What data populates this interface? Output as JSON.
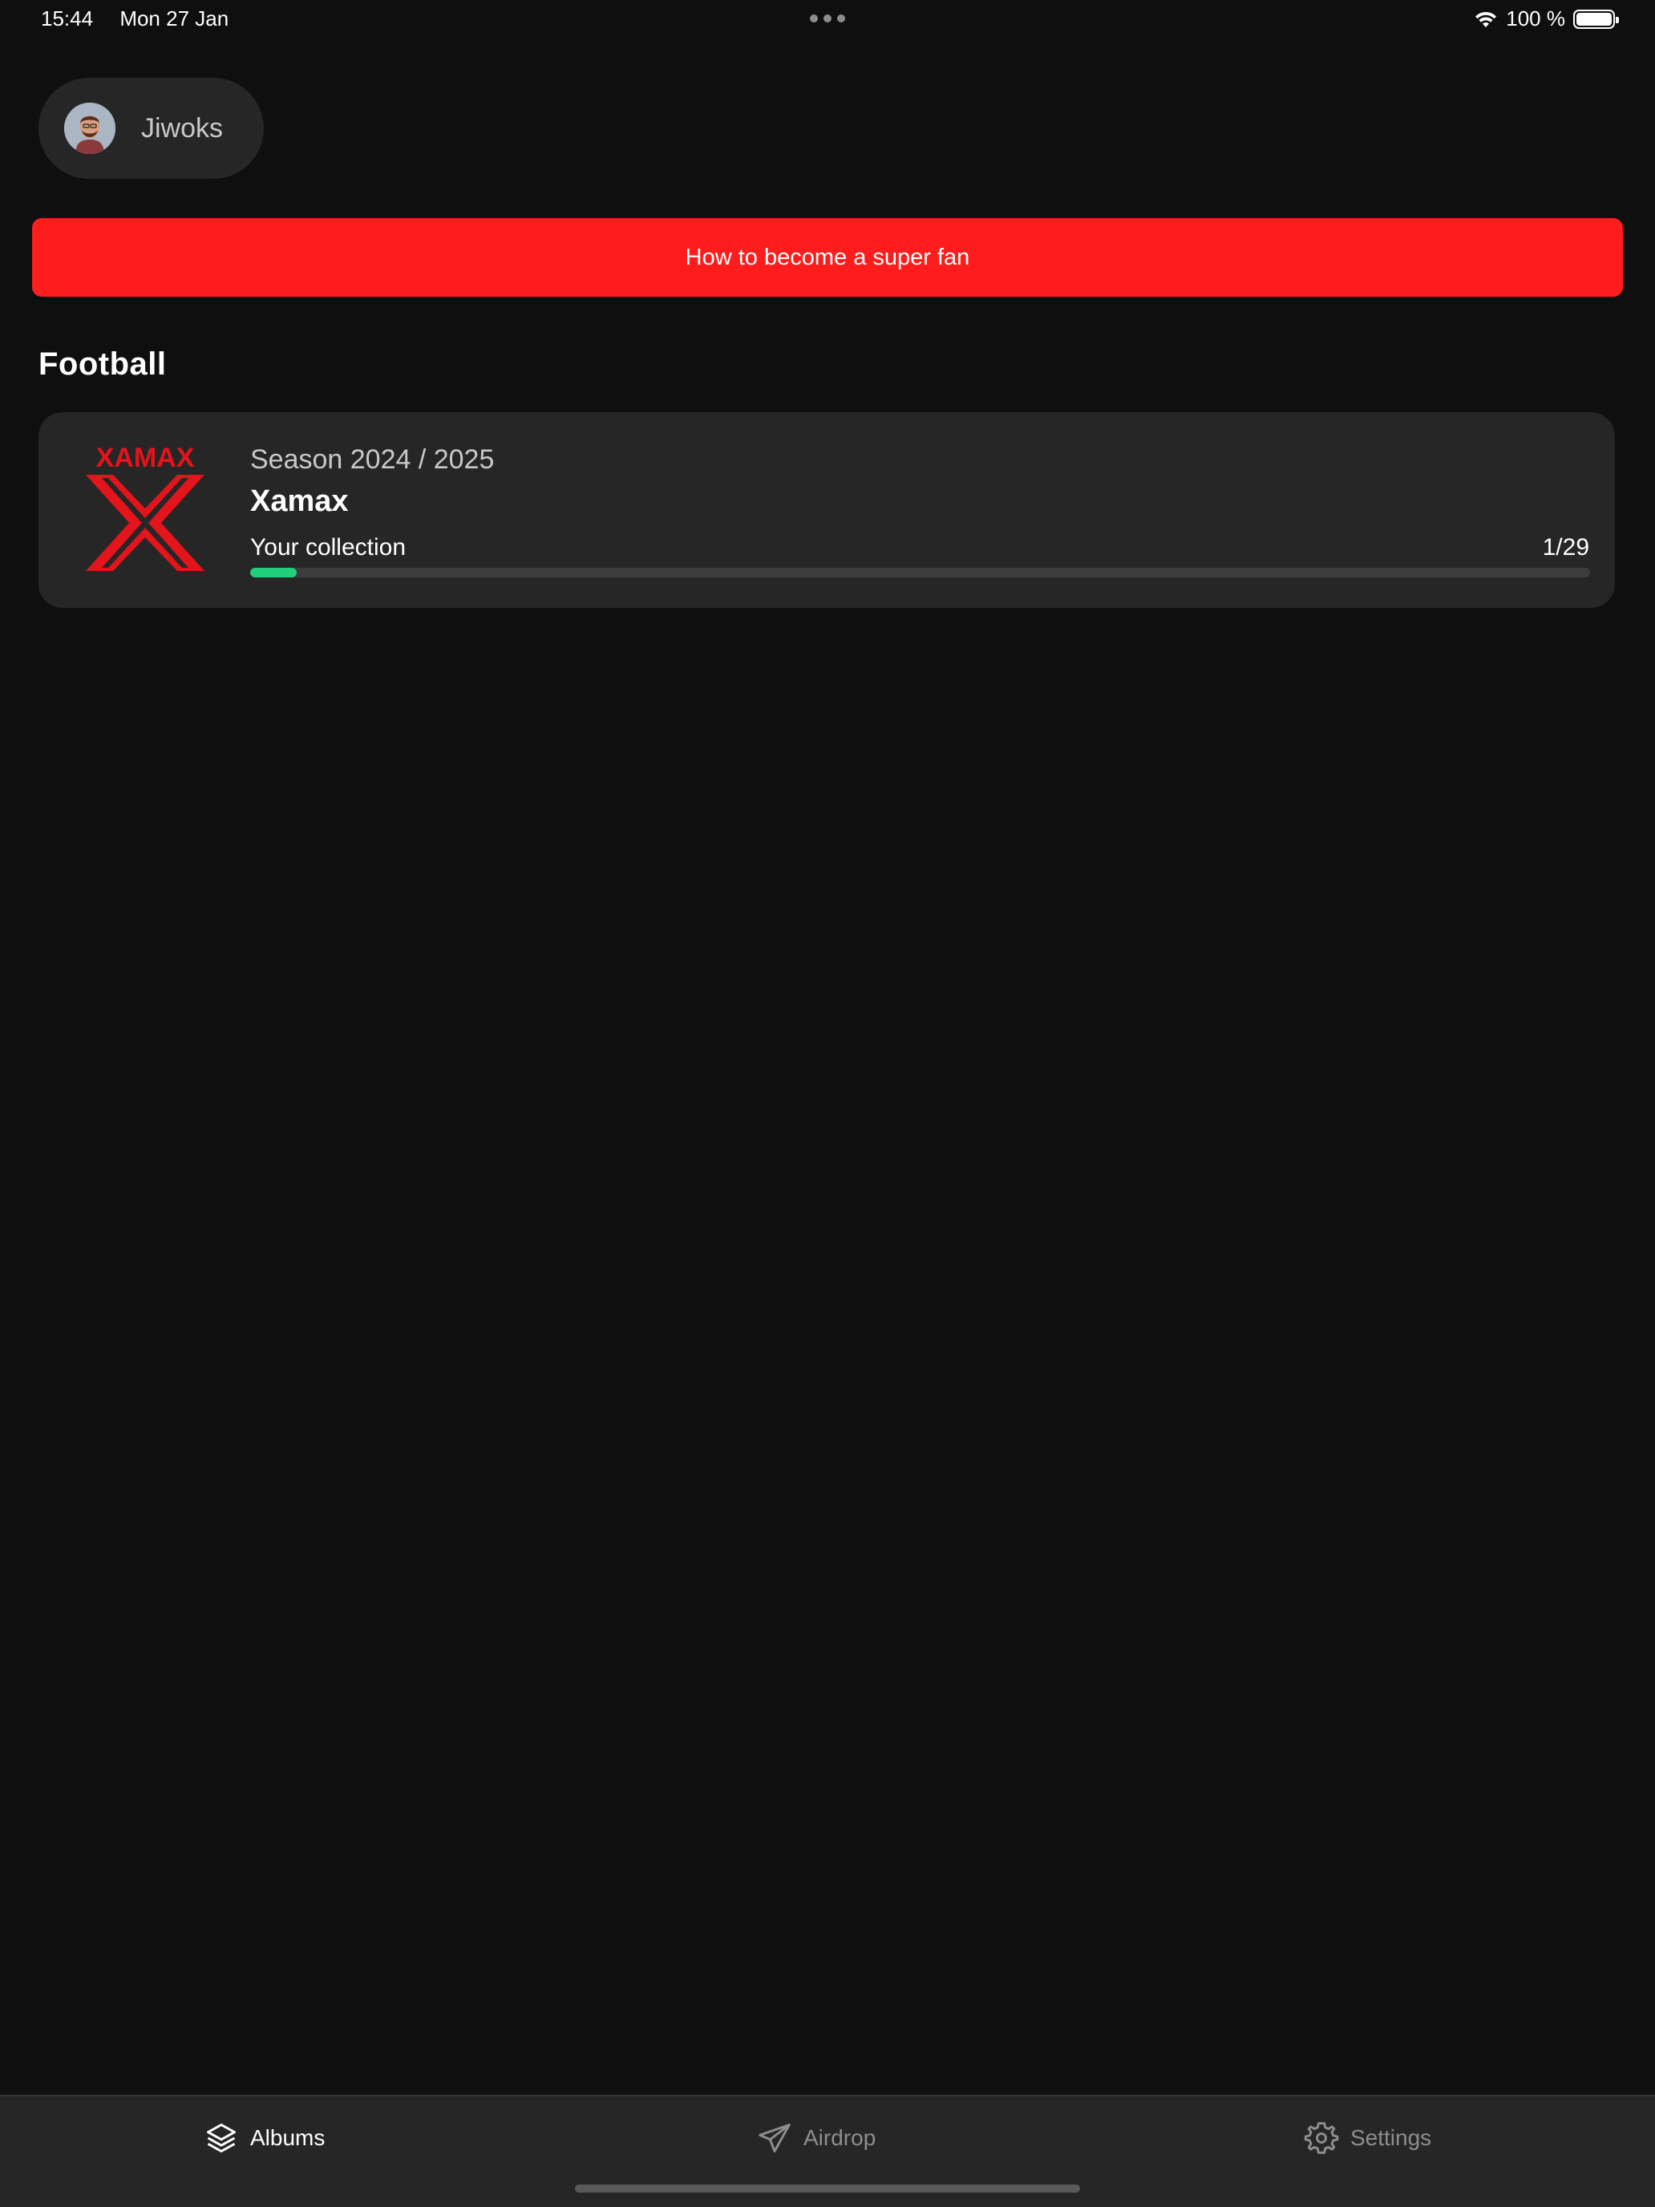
{
  "status_bar": {
    "time": "15:44",
    "date": "Mon 27 Jan",
    "battery_text": "100 %",
    "battery_level": 1.0,
    "icons": [
      "wifi-icon",
      "battery-icon",
      "more-dots-icon"
    ]
  },
  "profile": {
    "name": "Jiwoks",
    "avatar_icon": "user-avatar"
  },
  "banner": {
    "label": "How to become a super fan",
    "color": "#ff1c1c"
  },
  "section": {
    "title": "Football"
  },
  "album": {
    "logo_text": "XAMAX",
    "season": "Season 2024 / 2025",
    "club": "Xamax",
    "collection_label": "Your collection",
    "collection_count": "1/29",
    "collected": 1,
    "total": 29,
    "progress_color": "#1fd07a",
    "logo_color": "#e3141b"
  },
  "tab_bar": {
    "tabs": [
      {
        "label": "Albums",
        "icon": "layers-icon",
        "active": true
      },
      {
        "label": "Airdrop",
        "icon": "paper-plane-icon",
        "active": false
      },
      {
        "label": "Settings",
        "icon": "gear-icon",
        "active": false
      }
    ]
  }
}
